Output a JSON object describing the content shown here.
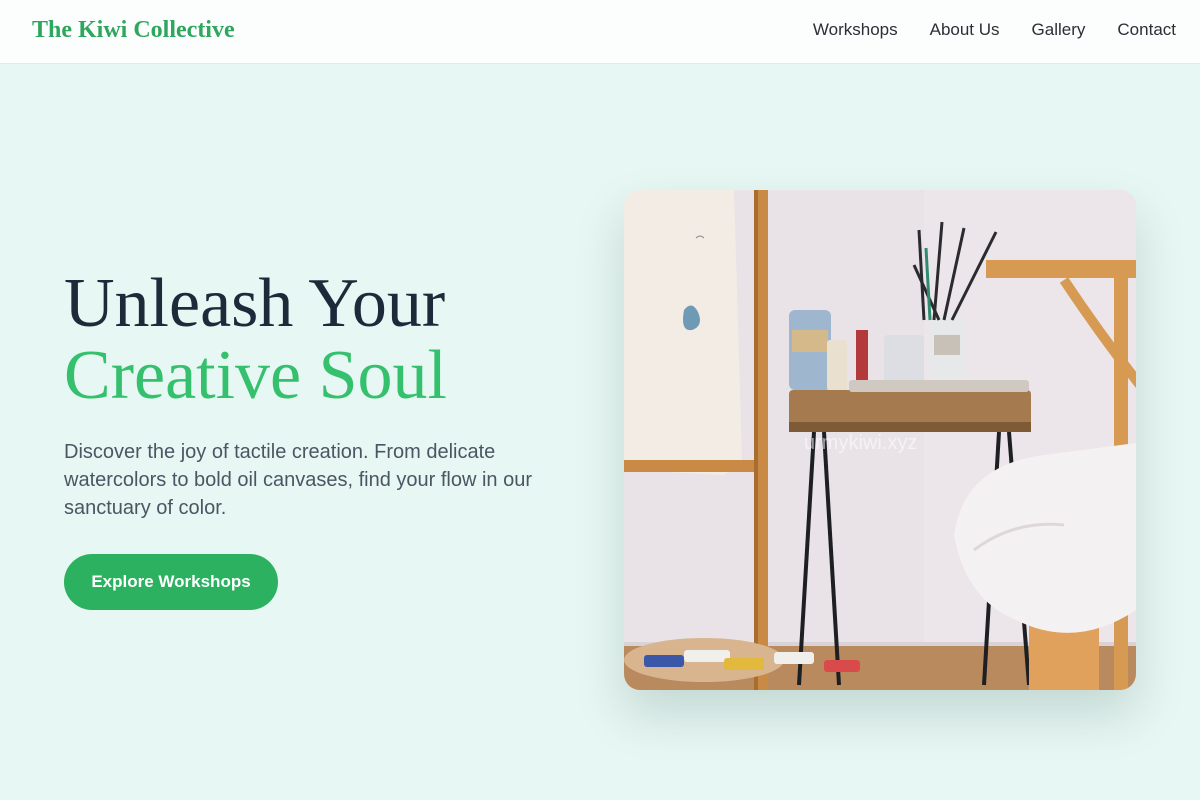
{
  "navbar": {
    "logo": "The Kiwi Collective",
    "links": [
      {
        "label": "Workshops"
      },
      {
        "label": "About Us"
      },
      {
        "label": "Gallery"
      },
      {
        "label": "Contact"
      }
    ]
  },
  "hero": {
    "title_line1": "Unleash Your",
    "title_line2": "Creative Soul",
    "description": "Discover the joy of tactile creation. From delicate watercolors to bold oil canvases, find your flow in our sanctuary of color.",
    "cta_label": "Explore Workshops",
    "image_watermark": "urmykiwi.xyz"
  },
  "colors": {
    "page_background": "#e7f7f3",
    "brand_green": "#2fa65e",
    "accent_green": "#34c06c",
    "button_green": "#2bb160",
    "heading_dark": "#1c2b3a"
  }
}
